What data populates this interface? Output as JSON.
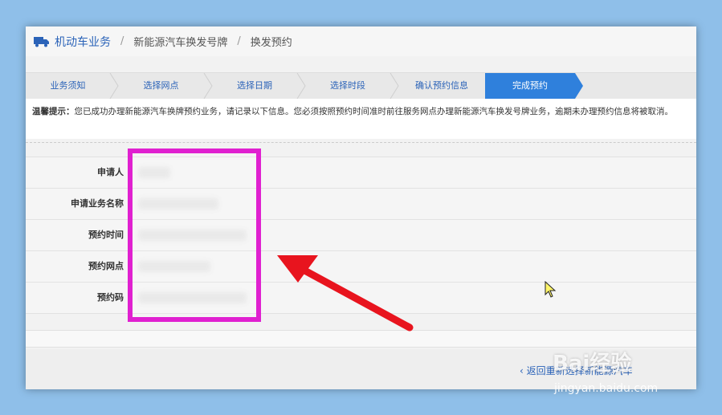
{
  "breadcrumb": {
    "root": "机动车业务",
    "sep": "/",
    "level2": "新能源汽车换发号牌",
    "level3": "换发预约"
  },
  "steps": [
    "业务须知",
    "选择网点",
    "选择日期",
    "选择时段",
    "确认预约信息",
    "完成预约"
  ],
  "active_step": "完成预约",
  "notice": {
    "label": "温馨提示：",
    "text": "您已成功办理新能源汽车换牌预约业务，请记录以下信息。您必须按照预约时间准时前往服务网点办理新能源汽车换发号牌业务，逾期未办理预约信息将被取消。"
  },
  "form": {
    "applicant_label": "申请人",
    "business_label": "申请业务名称",
    "time_label": "预约时间",
    "site_label": "预约网点",
    "code_label": "预约码"
  },
  "footer": {
    "back_label": "返回重新选择新能源汽车"
  },
  "watermark": {
    "brand": "Bai经验",
    "url": "jingyan.baidu.com"
  },
  "colors": {
    "accent": "#2f80dc",
    "link": "#2b63b8",
    "highlight": "#e020d0",
    "arrow": "#e8141e"
  }
}
